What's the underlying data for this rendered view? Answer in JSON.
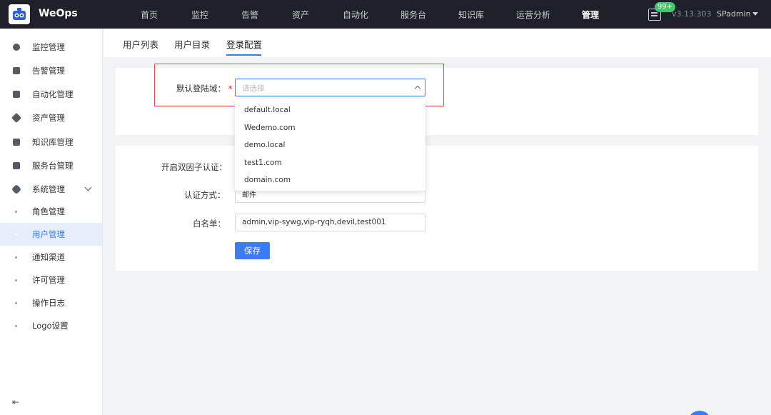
{
  "app": {
    "name": "WeOps",
    "version": "v3.13.303",
    "user": "SPadmin",
    "notification_count": "99+"
  },
  "nav": [
    "首页",
    "监控",
    "告警",
    "资产",
    "自动化",
    "服务台",
    "知识库",
    "运营分析",
    "管理"
  ],
  "nav_active": "管理",
  "sidebar": {
    "items": [
      {
        "label": "监控管理",
        "icon": "monitor-icon"
      },
      {
        "label": "告警管理",
        "icon": "alarm-icon"
      },
      {
        "label": "自动化管理",
        "icon": "automation-icon"
      },
      {
        "label": "资产管理",
        "icon": "layers-icon"
      },
      {
        "label": "知识库管理",
        "icon": "book-icon"
      },
      {
        "label": "服务台管理",
        "icon": "clipboard-icon"
      },
      {
        "label": "系统管理",
        "icon": "gear-icon"
      }
    ],
    "sub_items": [
      "角色管理",
      "用户管理",
      "通知渠道",
      "许可管理",
      "操作日志",
      "Logo设置"
    ],
    "active_sub": "用户管理"
  },
  "tabs": [
    "用户列表",
    "用户目录",
    "登录配置"
  ],
  "active_tab": "登录配置",
  "login_domain": {
    "label": "默认登陆域：",
    "required_mark": "*",
    "placeholder": "请选择",
    "options": [
      "default.local",
      "Wedemo.com",
      "demo.local",
      "test1.com",
      "domain.com"
    ]
  },
  "mfa": {
    "enable_label": "开启双因子认证：",
    "method_label": "认证方式：",
    "method_value": "邮件",
    "whitelist_label": "白名单：",
    "whitelist_value": "admin,vip-sywg,vip-ryqh,devil,test001",
    "save_label": "保存"
  },
  "colors": {
    "accent": "#3b7cf6",
    "topbar": "#1e2129",
    "highlight": "#e54d4d",
    "badge": "#3ec86b"
  }
}
